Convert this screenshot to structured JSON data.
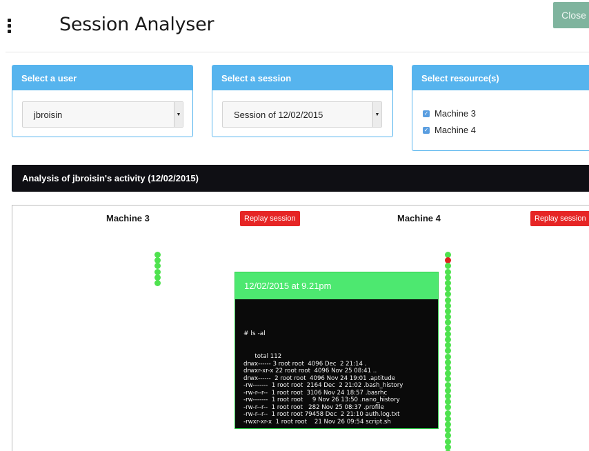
{
  "header": {
    "title": "Session Analyser",
    "close_label": "Close"
  },
  "user_panel": {
    "title": "Select a user",
    "selected": "jbroisin"
  },
  "session_panel": {
    "title": "Select a session",
    "selected": "Session of 12/02/2015"
  },
  "resource_panel": {
    "title": "Select resource(s)",
    "items": [
      {
        "label": "Machine 3",
        "checked": true
      },
      {
        "label": "Machine 4",
        "checked": true
      }
    ]
  },
  "analysis_title": "Analysis of jbroisin's activity (12/02/2015)",
  "timeline": {
    "machines": [
      {
        "name": "Machine 3",
        "replay_label": "Replay session"
      },
      {
        "name": "Machine 4",
        "replay_label": "Replay session"
      }
    ],
    "machine3_event_count": 6,
    "machine4_event_count": 36,
    "machine4_selected_event": 2
  },
  "popup": {
    "timestamp": "12/02/2015 at 9.21pm",
    "command": "# ls -al",
    "output": [
      "total 112",
      "drwx------ 3 root root  4096 Dec  2 21:14 .",
      "drwxr-xr-x 22 root root  4096 Nov 25 08:41 ..",
      "drwx------  2 root root  4096 Nov 24 19:01 .aptitude",
      "-rw-------  1 root root  2164 Dec  2 21:02 .bash_history",
      "-rw-r--r--  1 root root  3106 Nov 24 18:57 .basrhc",
      "-rw-------  1 root root     9 Nov 26 13:50 .nano_history",
      "-rw-r--r--  1 root root   282 Nov 25 08:37 .profile",
      "-rw-r--r--  1 root root 79458 Dec  2 21:10 auth.log.txt",
      "-rwxr-xr-x  1 root root    21 Nov 26 09:54 script.sh"
    ]
  },
  "colors": {
    "panel_accent": "#56b4ee",
    "close_button": "#7fb49e",
    "replay_button": "#e62525",
    "event_dot": "#4fe24f",
    "selected_event_dot": "#e0201e",
    "popup_header": "#4de870"
  }
}
